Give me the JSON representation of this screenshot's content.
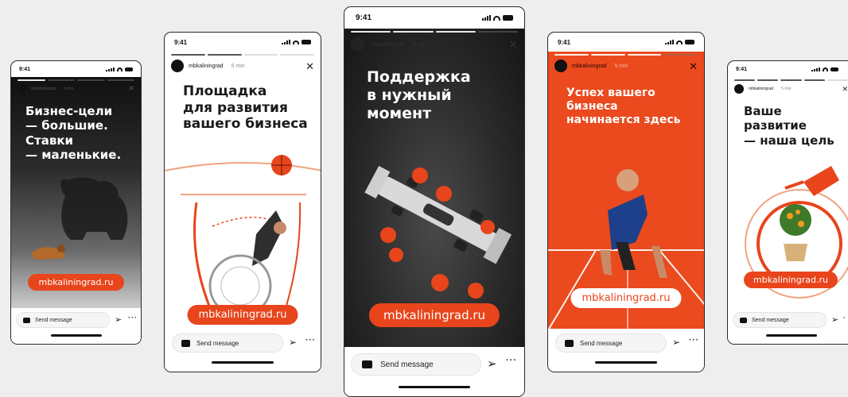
{
  "phones": [
    {
      "time": "9:41",
      "username": "mbkaliningrad",
      "posted": "5 min",
      "headline": "Бизнес-цели\n— большие.\nСтавки\n— маленькие.",
      "cta": "mbkaliningrad.ru",
      "message_placeholder": "Send message",
      "close_icon": "close-icon",
      "theme": {
        "bg": "#2a2a2a",
        "text": "#ffffff",
        "pill_bg": "#e8451c",
        "pill_text": "#ffffff"
      }
    },
    {
      "time": "9:41",
      "username": "mbkaliningrad",
      "posted": "5 min",
      "headline": "Площадка\nдля развития\nвашего бизнеса",
      "cta": "mbkaliningrad.ru",
      "message_placeholder": "Send message",
      "theme": {
        "bg": "#ffffff",
        "text": "#1a1a1a",
        "pill_bg": "#e8451c",
        "pill_text": "#ffffff"
      }
    },
    {
      "time": "9:41",
      "username": "mbkaliningrad",
      "posted": "5 min",
      "headline": "Поддержка\nв нужный\nмомент",
      "cta": "mbkaliningrad.ru",
      "message_placeholder": "Send message",
      "theme": {
        "bg": "#1f1f1f",
        "text": "#ffffff",
        "pill_bg": "#e8451c",
        "pill_text": "#ffffff"
      }
    },
    {
      "time": "9:41",
      "username": "mbkaliningrad",
      "posted": "5 min",
      "headline": "Успех вашего\nбизнеса\nначинается здесь",
      "cta": "mbkaliningrad.ru",
      "message_placeholder": "Send message",
      "theme": {
        "bg": "#ea4a1e",
        "text": "#ffffff",
        "pill_bg": "#ffffff",
        "pill_text": "#e8451c"
      }
    },
    {
      "time": "9:41",
      "username": "mbkaliningrad",
      "posted": "5 min",
      "headline": "Ваше\nразвитие\n— наша цель",
      "cta": "mbkaliningrad.ru",
      "message_placeholder": "Send message",
      "theme": {
        "bg": "#ffffff",
        "text": "#1a1a1a",
        "pill_bg": "#e8451c",
        "pill_text": "#ffffff"
      }
    }
  ],
  "colors": {
    "brand_orange": "#e8451c",
    "page_bg": "#eeeeee"
  },
  "icons": {
    "camera": "camera-icon",
    "send": "send-icon",
    "more": "more-icon",
    "close": "close-icon"
  }
}
